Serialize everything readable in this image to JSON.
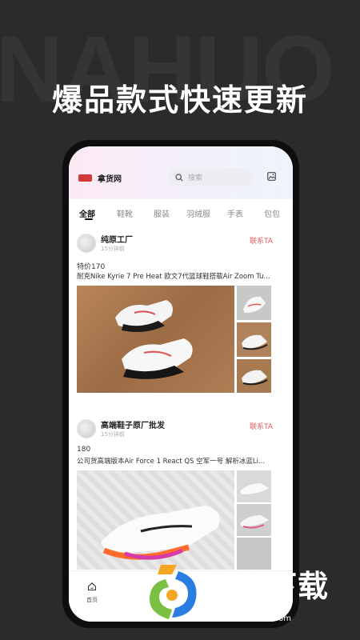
{
  "background_word": "NAHUO",
  "headline": "爆品款式快速更新",
  "app": {
    "name": "拿货网",
    "search_placeholder": "搜索",
    "tabs": [
      {
        "label": "全部"
      },
      {
        "label": "鞋靴"
      },
      {
        "label": "服装"
      },
      {
        "label": "羽绒服"
      },
      {
        "label": "手表"
      },
      {
        "label": "包包"
      }
    ],
    "active_tab": "全部",
    "posts": [
      {
        "shop": "纯原工厂",
        "time": "15分钟前",
        "contact": "联系TA",
        "price": "特价170",
        "description": "耐克Nike Kyrie 7 Pre Heat 欧文7代篮球鞋搭载Air Zoom Tu..."
      },
      {
        "shop": "高端鞋子原厂批发",
        "time": "15分钟前",
        "contact": "联系TA",
        "price": "180",
        "description": "公司货高端版本Air Force 1 React QS 空军一号 解析冰蓝Li..."
      }
    ],
    "bottom_nav": {
      "home_label": "首页"
    }
  },
  "watermark": {
    "title": "传统下载",
    "url": "ctdown.com"
  },
  "colors": {
    "accent_red": "#e05a5a",
    "background": "#2b2b2b"
  }
}
